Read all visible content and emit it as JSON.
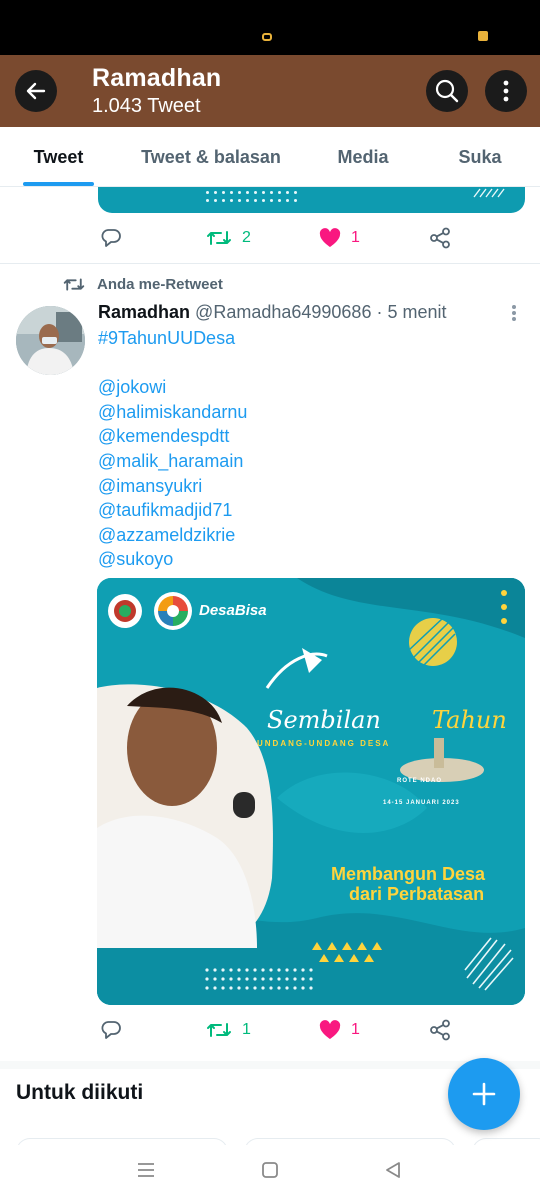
{
  "header": {
    "title": "Ramadhan",
    "subtitle": "1.043 Tweet"
  },
  "tabs": [
    {
      "label": "Tweet",
      "active": true
    },
    {
      "label": "Tweet & balasan",
      "active": false
    },
    {
      "label": "Media",
      "active": false
    },
    {
      "label": "Suka",
      "active": false
    }
  ],
  "prev_tweet": {
    "retweets": "2",
    "likes": "1"
  },
  "tweet": {
    "retweet_context": "Anda me-Retweet",
    "author_name": "Ramadhan",
    "author_meta": "@Ramadha64990686 · 5 menit",
    "lines": [
      "#9TahunUUDesa",
      "",
      "@jokowi",
      "@halimiskandarnu",
      "@kemendespdtt",
      "@malik_haramain",
      "@imansyukri",
      "@taufikmadjid71",
      "@azzameldzikrie",
      "@sukoyo"
    ],
    "media": {
      "brand": "DesaBisa",
      "headline_a": "Sembilan",
      "headline_b": "Tahun",
      "subheading": "UNDANG-UNDANG DESA",
      "location": "ROTE NDAO",
      "dates": "14-15 JANUARI 2023",
      "quote_line1": "Membangun Desa",
      "quote_line2": "dari Perbatasan"
    },
    "retweets": "1",
    "likes": "1"
  },
  "follow_section": {
    "title": "Untuk diikuti"
  },
  "colors": {
    "header_bg": "#7a4a2f",
    "accent": "#1d9bf0",
    "retweet": "#00ba7c",
    "like": "#f91880",
    "poster_teal": "#0f9fb3",
    "poster_yellow": "#ffd43c"
  },
  "icons": [
    "back-arrow-icon",
    "search-icon",
    "more-vertical-icon",
    "reply-icon",
    "retweet-icon",
    "heart-icon",
    "share-icon",
    "plus-icon",
    "menu-icon",
    "home-square-icon",
    "back-triangle-icon"
  ]
}
